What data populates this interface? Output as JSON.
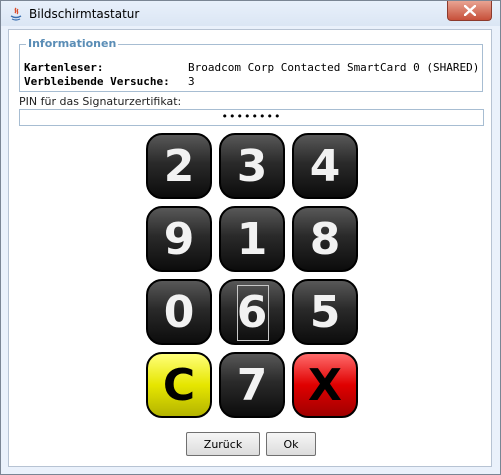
{
  "window": {
    "title": "Bildschirmtastatur"
  },
  "info": {
    "legend": "Informationen",
    "card_reader_label": "Kartenleser:",
    "card_reader_value": "Broadcom Corp Contacted SmartCard 0 (SHARED)",
    "attempts_label": "Verbleibende Versuche:",
    "attempts_value": "3"
  },
  "pin": {
    "label": "PIN für das Signaturzertifikat:",
    "masked_value": "••••••••"
  },
  "keypad": {
    "rows": [
      [
        "2",
        "3",
        "4"
      ],
      [
        "9",
        "1",
        "8"
      ],
      [
        "0",
        "6",
        "5"
      ],
      [
        "C",
        "7",
        "X"
      ]
    ],
    "focused_key": "6",
    "colors": {
      "dark": "#1c1c1c",
      "clear": "#e6e600",
      "cancel": "#e00000"
    }
  },
  "buttons": {
    "back": "Zurück",
    "ok": "Ok"
  }
}
